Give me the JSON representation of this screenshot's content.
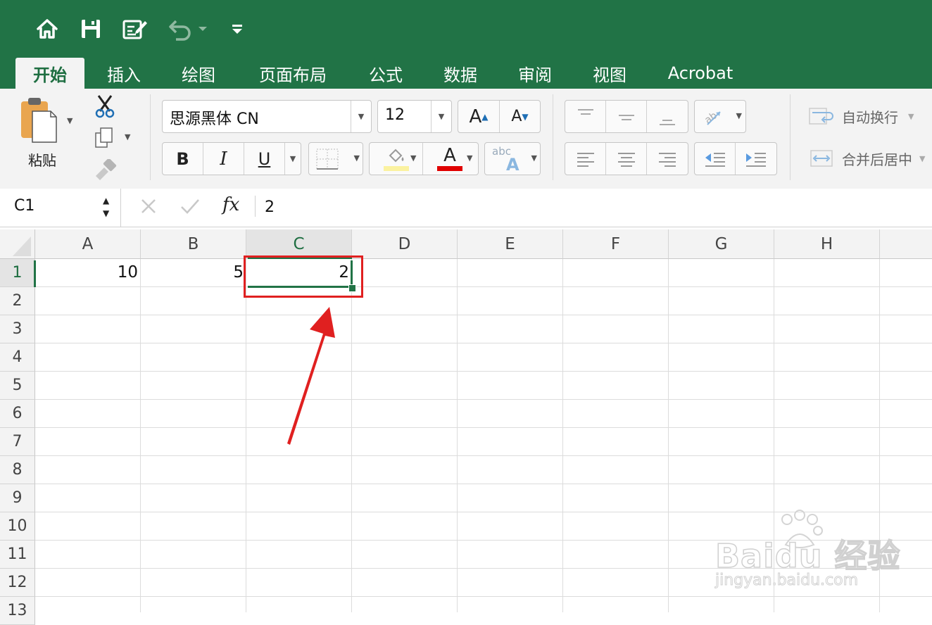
{
  "quick_access": {
    "icons": [
      "home-icon",
      "save-icon",
      "edit-document-icon",
      "undo-icon",
      "customize-toolbar-icon"
    ]
  },
  "tabs": [
    "开始",
    "插入",
    "绘图",
    "页面布局",
    "公式",
    "数据",
    "审阅",
    "视图",
    "Acrobat"
  ],
  "active_tab": "开始",
  "ribbon": {
    "paste_label": "粘贴",
    "font_name": "思源黑体 CN",
    "font_size": "12",
    "bold": "B",
    "italic": "I",
    "underline": "U",
    "font_color": "#e00000",
    "highlight_color": "#fbf2a0",
    "grow_font": "A",
    "shrink_font": "A",
    "phonetic_small": "abc",
    "phonetic_big": "A",
    "wrap_text_label": "自动换行",
    "merge_center_label": "合并后居中"
  },
  "formula_bar": {
    "name_box": "C1",
    "fx": "fx",
    "value": "2"
  },
  "sheet": {
    "columns": [
      "A",
      "B",
      "C",
      "D",
      "E",
      "F",
      "G",
      "H"
    ],
    "rows": [
      "1",
      "2",
      "3",
      "4",
      "5",
      "6",
      "7",
      "8",
      "9",
      "10",
      "11",
      "12",
      "13"
    ],
    "cells": {
      "A1": "10",
      "B1": "5",
      "C1": "2"
    },
    "selected_cell": "C1"
  },
  "annotation": {
    "highlight_color": "#e02020"
  },
  "watermark": {
    "brand": "Baidu 经验",
    "url": "jingyan.baidu.com"
  }
}
